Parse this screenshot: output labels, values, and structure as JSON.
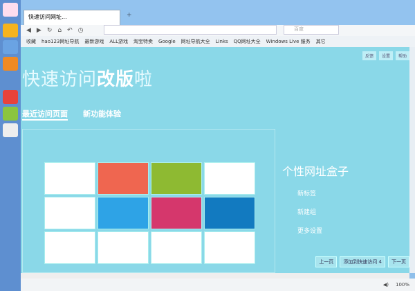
{
  "tab": {
    "title": "快速访问网址..."
  },
  "bookmarks": [
    "收藏",
    "hao123网址导航",
    "最新游戏",
    "ALL游戏",
    "淘宝特卖",
    "Google",
    "网址导航大全",
    "Links",
    "QQ网址大全",
    "Windows Live 服务",
    "其它"
  ],
  "search": {
    "placeholder": "百度"
  },
  "headline": {
    "normal": "快速访问",
    "bold": "改版",
    "tail": "啦"
  },
  "top_buttons": [
    "反馈",
    "设置",
    "帮助"
  ],
  "tabs": [
    {
      "label": "最近访问页面"
    },
    {
      "label": "新功能体验"
    }
  ],
  "box": {
    "title": "个性网址盒子",
    "links": [
      "新标签",
      "新建组",
      "更多设置"
    ]
  },
  "pager": {
    "prev": "上一页",
    "middle": "添加到快速访问 4",
    "next": "下一页"
  },
  "status": {
    "zoom": "100%"
  },
  "tile_colors": [
    "#ffffff",
    "#ef6650",
    "#8eba32",
    "#ffffff",
    "#ffffff",
    "#2ea3e6",
    "#d5376c",
    "#127ac0",
    "#ffffff",
    "#ffffff",
    "#ffffff",
    "#ffffff"
  ]
}
